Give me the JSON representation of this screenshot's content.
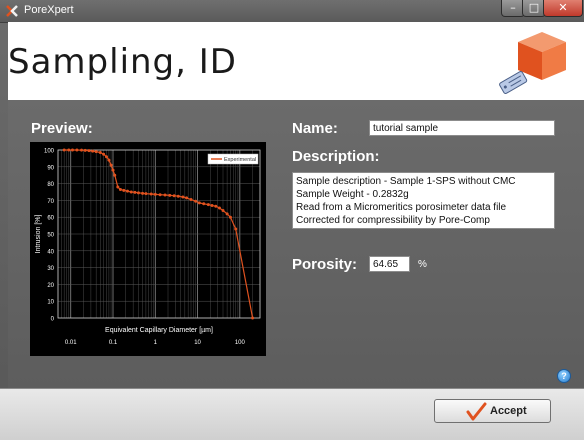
{
  "window": {
    "title": "PoreXpert",
    "minimize": "–",
    "maximize": "□",
    "close": "✕"
  },
  "header": {
    "title": "Sampling, ID",
    "logo_icon": "cube-tag-icon"
  },
  "preview": {
    "label": "Preview:"
  },
  "name": {
    "label": "Name:",
    "value": "tutorial sample"
  },
  "description": {
    "label": "Description:",
    "lines": [
      "Sample description - Sample 1-SPS without CMC",
      "Sample Weight - 0.2832g",
      "Read from a Micromeritics porosimeter data file",
      "Corrected for compressibility by Pore-Comp"
    ]
  },
  "porosity": {
    "label": "Porosity:",
    "value": "64.65",
    "unit": "%"
  },
  "help": {
    "glyph": "?"
  },
  "footer": {
    "accept_label": "Accept"
  },
  "colors": {
    "accent": "#e0521f",
    "panel": "#606060",
    "close": "#c0392b"
  },
  "chart_data": {
    "type": "line",
    "xlabel": "Equivalent Capillary Diameter [µm]",
    "ylabel": "Intrusion [%]",
    "x_scale": "log",
    "xlim": [
      0.005,
      300
    ],
    "ylim": [
      0,
      100
    ],
    "x_ticks": [
      "0.01",
      "0.1",
      "1",
      "10",
      "100"
    ],
    "y_ticks": [
      "0",
      "10",
      "20",
      "30",
      "40",
      "50",
      "60",
      "70",
      "80",
      "90",
      "100"
    ],
    "grid": true,
    "legend_position": "top-right",
    "series": [
      {
        "name": "Experimental",
        "color": "#e0521f",
        "x": [
          0.007,
          0.009,
          0.011,
          0.014,
          0.018,
          0.022,
          0.027,
          0.033,
          0.04,
          0.05,
          0.06,
          0.07,
          0.08,
          0.09,
          0.1,
          0.11,
          0.13,
          0.15,
          0.18,
          0.22,
          0.27,
          0.33,
          0.4,
          0.5,
          0.6,
          0.8,
          1,
          1.3,
          1.7,
          2.2,
          2.8,
          3.5,
          4.5,
          5.5,
          7,
          9,
          11,
          14,
          18,
          22,
          27,
          33,
          40,
          50,
          60,
          80,
          200
        ],
        "y": [
          100,
          100,
          100,
          100,
          99.9,
          99.8,
          99.6,
          99.3,
          99,
          98.5,
          97.5,
          96,
          94,
          91,
          88,
          85,
          78,
          76.5,
          76,
          75.5,
          75,
          74.8,
          74.5,
          74.2,
          74,
          73.8,
          73.6,
          73.4,
          73.2,
          73,
          72.8,
          72.5,
          72,
          71.5,
          70.5,
          69.5,
          68.5,
          68,
          67.5,
          67,
          66.5,
          65.5,
          64,
          62,
          60,
          53,
          0
        ]
      }
    ]
  }
}
